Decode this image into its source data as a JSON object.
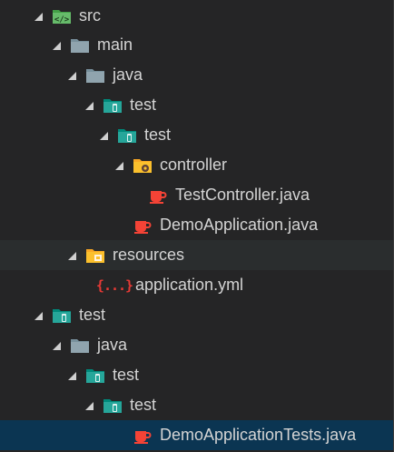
{
  "tree": {
    "items": [
      {
        "label": "src",
        "icon": "folder-src-icon",
        "expanded": true
      },
      {
        "label": "main",
        "icon": "folder-icon",
        "expanded": true
      },
      {
        "label": "java",
        "icon": "folder-icon",
        "expanded": true
      },
      {
        "label": "test",
        "icon": "folder-test-icon",
        "expanded": true
      },
      {
        "label": "test",
        "icon": "folder-test-icon",
        "expanded": true
      },
      {
        "label": "controller",
        "icon": "folder-controller-icon",
        "expanded": true
      },
      {
        "label": "TestController.java",
        "icon": "java-file-icon"
      },
      {
        "label": "DemoApplication.java",
        "icon": "java-file-icon"
      },
      {
        "label": "resources",
        "icon": "folder-resources-icon",
        "expanded": true,
        "hovered": true
      },
      {
        "label": "application.yml",
        "icon": "yaml-file-icon",
        "glyph": "{...}"
      },
      {
        "label": "test",
        "icon": "folder-test-icon",
        "expanded": true
      },
      {
        "label": "java",
        "icon": "folder-icon",
        "expanded": true
      },
      {
        "label": "test",
        "icon": "folder-test-icon",
        "expanded": true
      },
      {
        "label": "test",
        "icon": "folder-test-icon",
        "expanded": true
      },
      {
        "label": "DemoApplicationTests.java",
        "icon": "java-file-icon",
        "selected": true
      }
    ]
  },
  "colors": {
    "background": "#252526",
    "hover": "#2a2d2e",
    "selected": "#0b3552",
    "text": "#d4d4d4",
    "folder_gray": "#90a4ae",
    "folder_teal": "#26a69a",
    "folder_green": "#4caf50",
    "folder_yellow": "#fbc02d",
    "java_red": "#f44336"
  }
}
